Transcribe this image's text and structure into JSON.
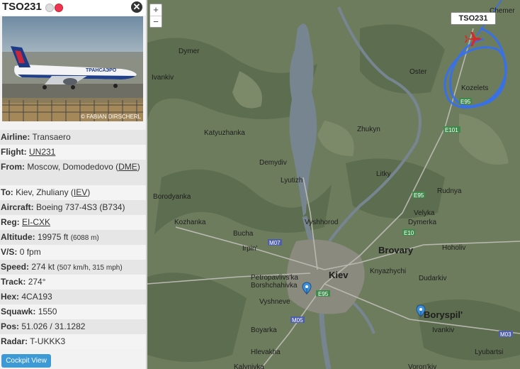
{
  "panel": {
    "callsign": "TSO231",
    "photo_credit": "© FABIAN DIRSCHERL",
    "rows": [
      {
        "label": "Airline:",
        "value": "Transaero"
      },
      {
        "label": "Flight:",
        "link": "UN231"
      },
      {
        "label": "From:",
        "value": "Moscow, Domodedovo (",
        "link": "DME",
        "suffix": ")"
      },
      {
        "label": "To:",
        "value": "Kiev, Zhuliany (",
        "link": "IEV",
        "suffix": ")"
      },
      {
        "label": "Aircraft:",
        "value": "Boeing 737-4S3 (B734)"
      },
      {
        "label": "Reg:",
        "link": "EI-CXK"
      },
      {
        "label": "Altitude:",
        "value": "19975 ft",
        "small": "(6088 m)"
      },
      {
        "label": "V/S:",
        "value": "0 fpm"
      },
      {
        "label": "Speed:",
        "value": "274 kt",
        "small": "(507 km/h, 315 mph)"
      },
      {
        "label": "Track:",
        "value": "274°"
      },
      {
        "label": "Hex:",
        "value": "4CA193"
      },
      {
        "label": "Squawk:",
        "value": "1550"
      },
      {
        "label": "Pos:",
        "value": "51.026 / 31.1282"
      },
      {
        "label": "Radar:",
        "value": "T-UKKK3"
      }
    ],
    "cockpit_button": "Cockpit View"
  },
  "map": {
    "zoom_in": "+",
    "zoom_out": "−",
    "flight_tag": "TSO231",
    "places": [
      "Chemer",
      "Dymer",
      "Oster",
      "Ivankiv",
      "Kozelets",
      "Katyuzhanka",
      "Zhukyn",
      "Demydiv",
      "Litky",
      "Lyutizh",
      "Borodyanka",
      "Rudnya",
      "Velyka Dymerka",
      "Kozhanka",
      "Vyshhorod",
      "Bucha",
      "Irpin'",
      "Brovary",
      "Hoholiv",
      "Petropavlivs'ka Borshchahivka",
      "Kiev",
      "Knyazhychi",
      "Dudarkiv",
      "Vyshneve",
      "Boryspil'",
      "Boyarka",
      "Ivankiv",
      "Hlevakha",
      "Lyubartsi",
      "Kalynivka",
      "Voron'kiv"
    ],
    "roads": [
      "E95",
      "E101",
      "E95",
      "E10",
      "M07",
      "E95",
      "M05",
      "M03"
    ]
  }
}
